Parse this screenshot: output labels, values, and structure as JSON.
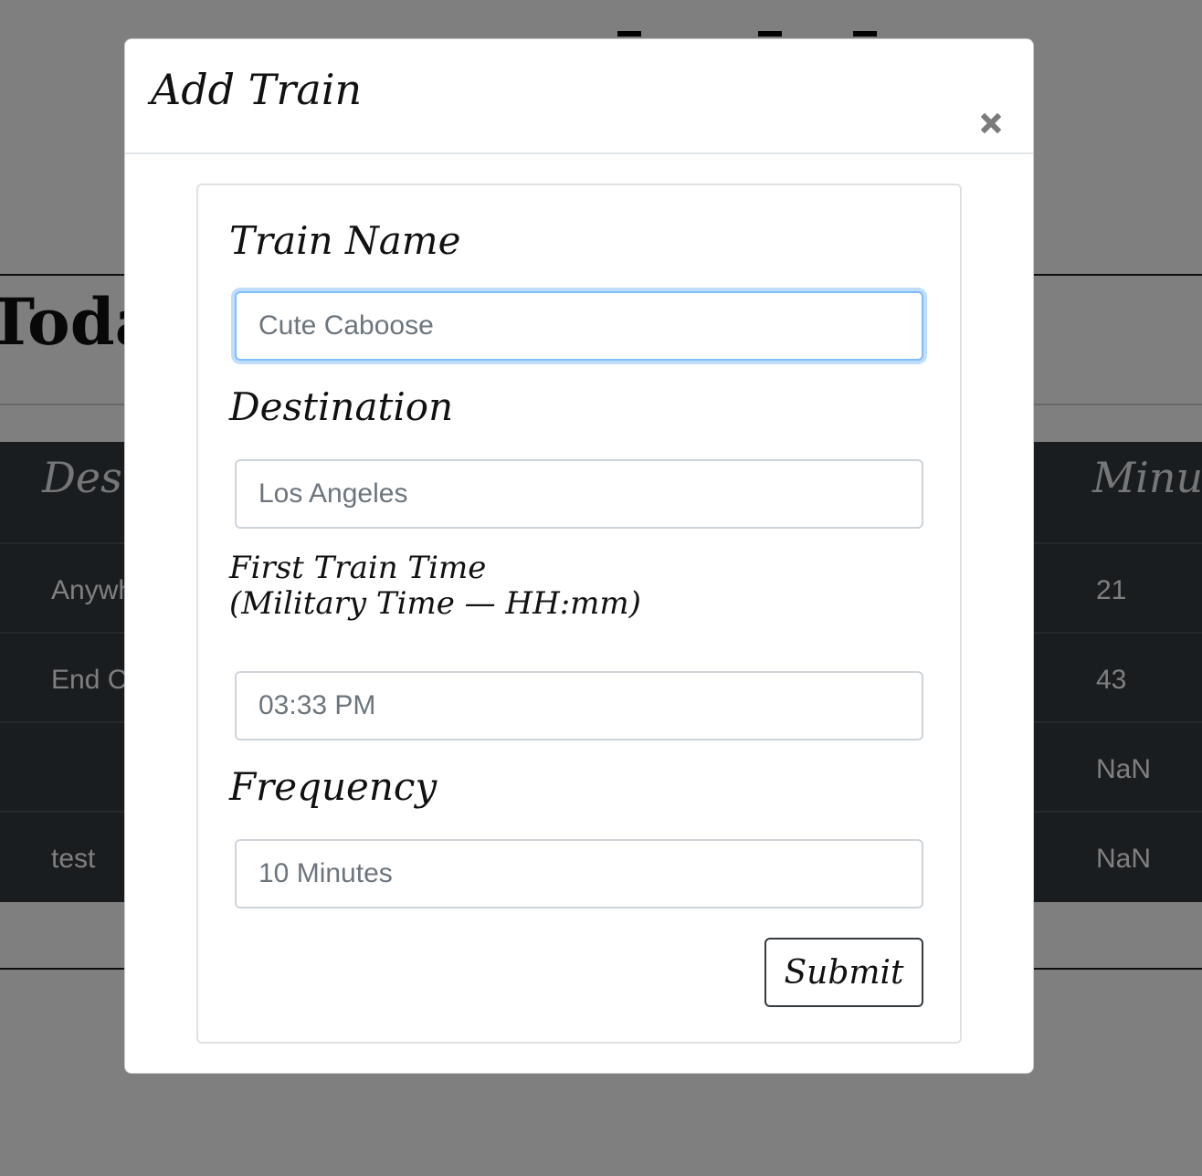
{
  "background": {
    "heading": "Toda",
    "table": {
      "headers": [
        "Desi",
        "Minut"
      ],
      "rows": [
        {
          "destination": "Anywh",
          "minutes": "21"
        },
        {
          "destination": "End C",
          "minutes": "43"
        },
        {
          "destination": "",
          "minutes": "NaN"
        },
        {
          "destination": "test",
          "minutes": "NaN"
        }
      ]
    }
  },
  "modal": {
    "title": "Add Train",
    "close_icon": "close-icon",
    "form": {
      "train_name": {
        "label": "Train Name",
        "placeholder": "Cute Caboose",
        "value": ""
      },
      "destination": {
        "label": "Destination",
        "placeholder": "Los Angeles",
        "value": ""
      },
      "first_train_time": {
        "label": "First Train Time\n(Military Time — HH:mm)",
        "placeholder": "03:33 PM",
        "value": ""
      },
      "frequency": {
        "label": "Frequency",
        "placeholder": "10 Minutes",
        "value": ""
      },
      "submit_label": "Submit"
    }
  },
  "colors": {
    "overlay": "#808080",
    "table_bg": "#343a40",
    "focus_border": "#80bdff",
    "input_border": "#ced4da"
  }
}
